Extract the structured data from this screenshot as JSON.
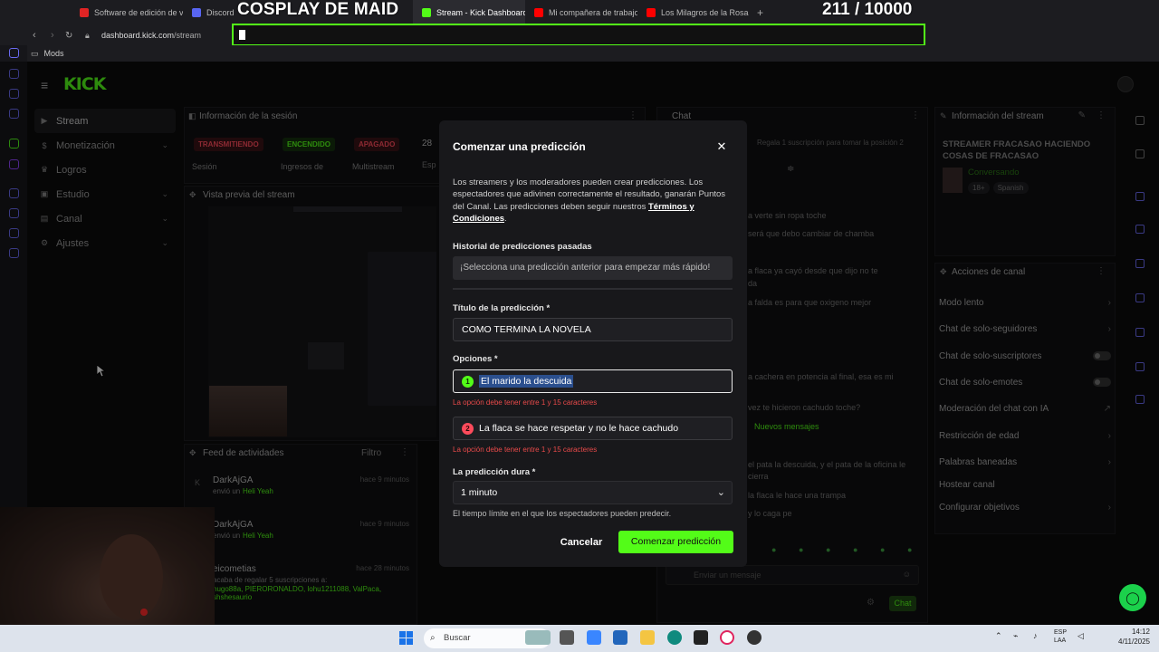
{
  "browser": {
    "tabs": [
      {
        "label": "Software de edición de vi",
        "color": "#e02424",
        "active": false
      },
      {
        "label": "Discord | #",
        "color": "#5865f2",
        "active": false
      },
      {
        "label": "Stream - Kick Dashboard",
        "color": "#53fc18",
        "active": true
      },
      {
        "label": "Mi compañera de trabajo",
        "color": "#ff0000",
        "active": false
      },
      {
        "label": "Los Milagros de la Rosa P",
        "color": "#ff0000",
        "active": false
      }
    ],
    "url_host": "dashboard.kick.com",
    "url_path": "/stream",
    "bookmark": "Mods"
  },
  "overlay": {
    "title": "COSPLAY DE MAID",
    "count": "211",
    "goal": "/ 10000"
  },
  "kick": {
    "logo": "KICK"
  },
  "leftnav": [
    {
      "label": "Stream",
      "active": true,
      "chevron": false
    },
    {
      "label": "Monetización",
      "active": false,
      "chevron": true
    },
    {
      "label": "Logros",
      "active": false,
      "chevron": false
    },
    {
      "label": "Estudio",
      "active": false,
      "chevron": true
    },
    {
      "label": "Canal",
      "active": false,
      "chevron": true
    },
    {
      "label": "Ajustes",
      "active": false,
      "chevron": true
    }
  ],
  "session": {
    "title": "Información de la sesión",
    "badges": [
      {
        "label": "TRANSMITIENDO",
        "sub": "Sesión",
        "bg": "#3a1316",
        "fg": "#ff4b5c"
      },
      {
        "label": "ENCENDIDO",
        "sub": "Ingresos de",
        "bg": "#15300e",
        "fg": "#53fc18"
      },
      {
        "label": "APAGADO",
        "sub": "Multistream",
        "bg": "#3a1316",
        "fg": "#ff4b5c"
      }
    ],
    "extra_value": "28",
    "extra_sub": "Esp"
  },
  "preview": {
    "title": "Vista previa del stream"
  },
  "feed": {
    "title": "Feed de actividades",
    "filter": "Filtro",
    "items": [
      {
        "name": "DarkAjGA",
        "action": "envió un",
        "item": "Heli Yeah",
        "time": "hace 9 minutos"
      },
      {
        "name": "DarkAjGA",
        "action": "envió un",
        "item": "Heli Yeah",
        "time": "hace 9 minutos"
      },
      {
        "name": "eicometias",
        "action": "acaba de regalar 5 suscripciones a:",
        "item": "hugo88a, PIERORONALDO, lohu1211088, ValPaca, shshesaurio",
        "time": "hace 28 minutos"
      }
    ]
  },
  "chat": {
    "title": "Chat",
    "pinned": "Regala 1 suscripción para tomar la posición 2",
    "lines": [
      "a verte sin ropa toche",
      "será que debo cambiar de chamba",
      "a flaca ya cayó desde que dijo no te",
      "da",
      "a falda es para que oxigeno mejor",
      "a cachera en potencia al final, esa es mi",
      "vez te hicieron cachudo toche?",
      "el pata la descuida, y el pata de la oficina le",
      "cierra",
      "la flaca le hace una trampa",
      "y lo caga pe"
    ],
    "new_messages": "Nuevos mensajes",
    "send_placeholder": "Enviar un mensaje",
    "send_button": "Chat"
  },
  "stream_info": {
    "title": "Información del stream",
    "stream_title": "STREAMER FRACASAO HACIENDO COSAS DE FRACASAO",
    "category": "Conversando",
    "tags": [
      "18+",
      "Spanish"
    ]
  },
  "channel_actions": {
    "title": "Acciones de canal",
    "items": [
      {
        "label": "Modo lento",
        "kind": "chevron"
      },
      {
        "label": "Chat de solo-seguidores",
        "kind": "chevron"
      },
      {
        "label": "Chat de solo-suscriptores",
        "kind": "toggle"
      },
      {
        "label": "Chat de solo-emotes",
        "kind": "toggle"
      },
      {
        "label": "Moderación del chat con IA",
        "kind": "link"
      },
      {
        "label": "Restricción de edad",
        "kind": "chevron"
      },
      {
        "label": "Palabras baneadas",
        "kind": "chevron"
      },
      {
        "label": "Hostear canal",
        "kind": "none"
      },
      {
        "label": "Configurar objetivos",
        "kind": "chevron"
      }
    ]
  },
  "modal": {
    "title": "Comenzar una predicción",
    "description": "Los streamers y los moderadores pueden crear predicciones. Los espectadores que adivinen correctamente el resultado, ganarán Puntos del Canal. Las predicciones deben seguir nuestros",
    "terms_link": "Términos y Condiciones",
    "terms_period": ".",
    "history_label": "Historial de predicciones pasadas",
    "history_placeholder": "¡Selecciona una predicción anterior para empezar más rápido!",
    "title_label": "Título de la predicción *",
    "title_value": "COMO TERMINA LA NOVELA",
    "options_label": "Opciones *",
    "options": [
      {
        "num": "1",
        "value": "El marido la descuida",
        "color": "#53fc18",
        "error": "La opción debe tener entre 1 y 15 caracteres"
      },
      {
        "num": "2",
        "value": "La flaca se hace respetar y no le hace cachudo",
        "color": "#ff4b5c",
        "error": "La opción debe tener entre 1 y 15 caracteres"
      }
    ],
    "duration_label": "La predicción dura *",
    "duration_value": "1 minuto",
    "duration_help": "El tiempo límite en el que los espectadores pueden predecir.",
    "cancel": "Cancelar",
    "submit": "Comenzar predicción"
  },
  "taskbar": {
    "search_placeholder": "Buscar",
    "lang_1": "ESP",
    "lang_2": "LAA",
    "time": "14:12",
    "date": "4/11/2025"
  }
}
